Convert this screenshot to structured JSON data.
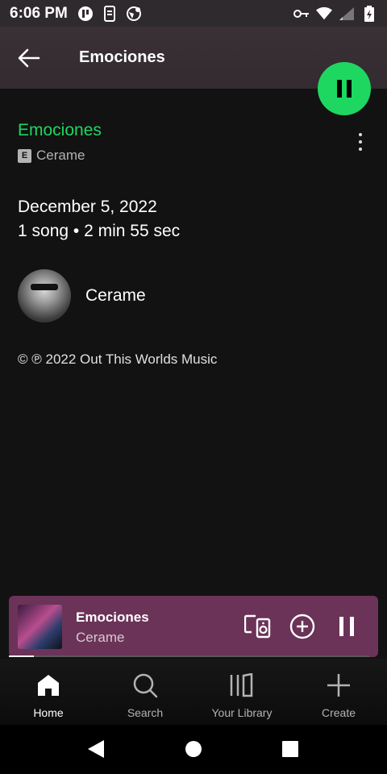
{
  "status_bar": {
    "time": "6:06 PM"
  },
  "header": {
    "title": "Emociones"
  },
  "album": {
    "title": "Emociones",
    "explicit_badge": "E",
    "artist": "Cerame",
    "release_date": "December 5, 2022",
    "meta": "1 song • 2 min 55 sec",
    "copyright": "© ℗ 2022 Out This Worlds Music"
  },
  "artist_card": {
    "name": "Cerame"
  },
  "mini_player": {
    "title": "Emociones",
    "artist": "Cerame",
    "progress": 0.07
  },
  "nav": {
    "items": [
      {
        "label": "Home",
        "icon": "home-icon",
        "active": true
      },
      {
        "label": "Search",
        "icon": "search-icon"
      },
      {
        "label": "Your Library",
        "icon": "library-icon"
      },
      {
        "label": "Create",
        "icon": "plus-icon"
      }
    ]
  },
  "colors": {
    "accent": "#1ed760",
    "background": "#121212",
    "mini_player": "#6b3358",
    "header": "#332b30"
  }
}
